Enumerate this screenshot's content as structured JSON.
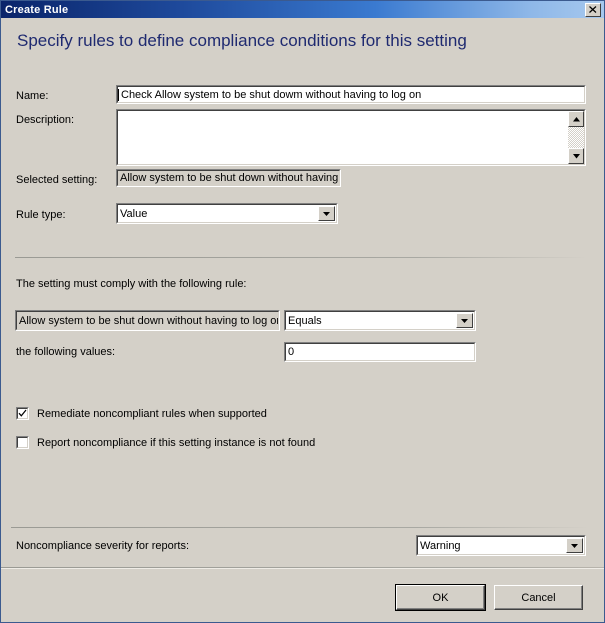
{
  "window": {
    "title": "Create Rule",
    "close_icon": "close-icon"
  },
  "heading": "Specify rules to define compliance conditions for this setting",
  "form": {
    "name_label": "Name:",
    "name_value": "Check Allow system to be shut dowm without having to log on",
    "description_label": "Description:",
    "description_value": "",
    "selected_setting_label": "Selected setting:",
    "selected_setting_value": "Allow system to be shut down without having t",
    "rule_type_label": "Rule type:",
    "rule_type_value": "Value"
  },
  "rule": {
    "comply_text": "The setting must comply with the following rule:",
    "condition_value": "Allow system to be shut down without having to log on",
    "operator_value": "Equals",
    "values_label": "the following values:",
    "values_value": "0"
  },
  "options": {
    "remediate_label": "Remediate noncompliant rules when supported",
    "remediate_checked": true,
    "report_label": "Report noncompliance if this setting instance is not found",
    "report_checked": false
  },
  "severity": {
    "label": "Noncompliance severity for reports:",
    "value": "Warning"
  },
  "buttons": {
    "ok": "OK",
    "cancel": "Cancel"
  },
  "colors": {
    "dialog_face": "#d4d0c8",
    "title_gradient_start": "#0a246a",
    "title_gradient_end": "#a6c8ee",
    "heading_text": "#1f2a70",
    "field_background": "#ffffff",
    "readonly_background": "#d4d0c8"
  }
}
